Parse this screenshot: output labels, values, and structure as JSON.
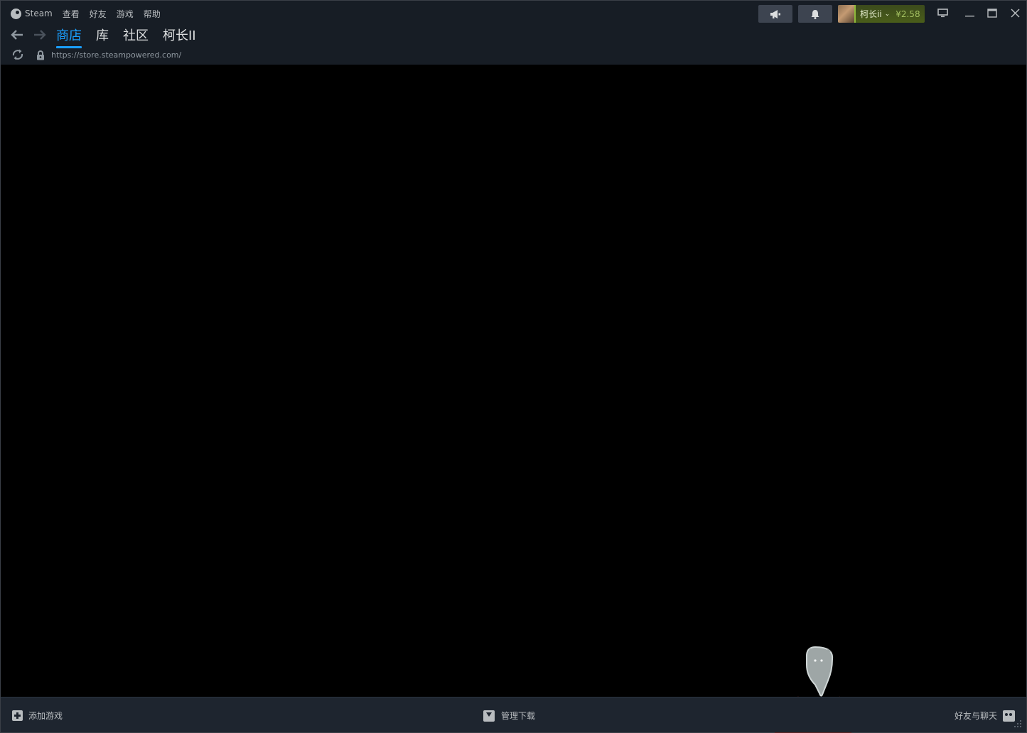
{
  "menu": {
    "app_name": "Steam",
    "items": [
      "查看",
      "好友",
      "游戏",
      "帮助"
    ]
  },
  "account": {
    "name": "柯长ii",
    "balance": "¥2.58"
  },
  "nav": {
    "tabs": [
      {
        "label": "商店",
        "active": true
      },
      {
        "label": "库",
        "active": false
      },
      {
        "label": "社区",
        "active": false
      },
      {
        "label": "柯长II",
        "active": false
      }
    ]
  },
  "url": {
    "text": "https://store.steampowered.com/"
  },
  "bottom": {
    "add_game": "添加游戏",
    "manage_downloads": "管理下载",
    "friends_chat": "好友与聊天"
  },
  "colors": {
    "accent": "#1a9fff",
    "bg": "#171d25",
    "content_bg": "#000000",
    "wallet_green": "#a4c161"
  },
  "icons": {
    "back": "arrow-left-icon",
    "forward": "arrow-right-icon",
    "reload": "reload-icon",
    "lock": "lock-icon",
    "announce": "megaphone-icon",
    "notify": "bell-icon",
    "big_picture": "monitor-icon",
    "minimize": "minimize-icon",
    "maximize": "maximize-icon",
    "close": "close-icon"
  }
}
